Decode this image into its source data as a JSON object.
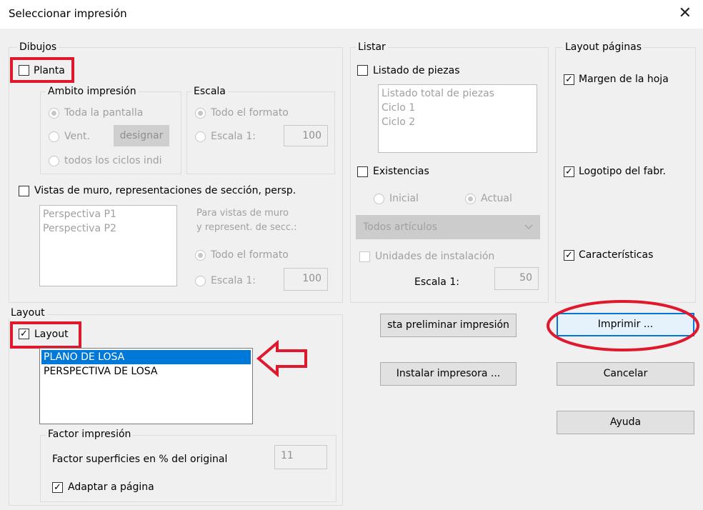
{
  "window": {
    "title": "Seleccionar impresión",
    "close_glyph": "✕"
  },
  "dibujos": {
    "group_label": "Dibujos",
    "planta": {
      "label": "Planta",
      "checked": false
    },
    "ambito": {
      "label": "Ambito impresión",
      "toda": "Toda la pantalla",
      "vent": "Vent.",
      "designar": "designar",
      "todos": "todos los ciclos indi"
    },
    "escala": {
      "label": "Escala",
      "todo": "Todo el formato",
      "escala": "Escala 1:",
      "value": "100"
    },
    "vistas": {
      "label": "Vistas de muro, representaciones de sección, persp.",
      "items": [
        "Perspectiva P1",
        "Perspectiva P2"
      ],
      "note1": "Para vistas de muro",
      "note2": "y represent. de secc.:",
      "todo": "Todo el formato",
      "escala": "Escala 1:",
      "value": "100"
    }
  },
  "listar": {
    "group_label": "Listar",
    "listado": {
      "label": "Listado de piezas",
      "items": [
        "Listado total de piezas",
        "Ciclo 1",
        "Ciclo 2"
      ]
    },
    "existencias": {
      "label": "Existencias",
      "inicial": "Inicial",
      "actual": "Actual"
    },
    "dropdown": {
      "value": "Todos artículos"
    },
    "unidades": {
      "label": "Unidades de instalación"
    },
    "escala": {
      "label": "Escala 1:",
      "value": "50"
    }
  },
  "layout_paginas": {
    "group_label": "Layout páginas",
    "margen": "Margen de la hoja",
    "logotipo": "Logotipo del fabr.",
    "caracteristicas": "Características"
  },
  "layout": {
    "group_label": "Layout",
    "checkbox": "Layout",
    "items": [
      "PLANO DE LOSA",
      "PERSPECTIVA DE LOSA"
    ],
    "factor": {
      "group_label": "Factor impresión",
      "label": "Factor superficies en % del original",
      "value": "11",
      "adaptar": "Adaptar a página"
    }
  },
  "buttons": {
    "preview": "sta preliminar impresión",
    "instalar": "Instalar impresora ...",
    "imprimir": "Imprimir ...",
    "cancelar": "Cancelar",
    "ayuda": "Ayuda"
  },
  "glyphs": {
    "check": "✓"
  },
  "annotations": {
    "color": "#e0182d"
  }
}
